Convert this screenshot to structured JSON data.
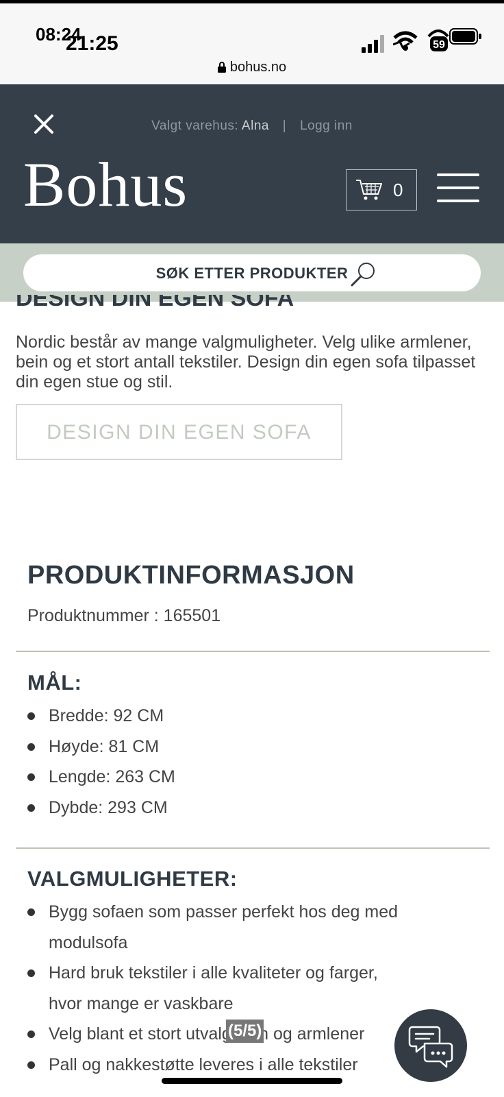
{
  "status_bar": {
    "time_primary": "08:24",
    "time_secondary": "21:25",
    "battery_level": "59",
    "url": "bohus.no"
  },
  "header": {
    "store_label": "Valgt varehus:",
    "store_name": "Alna",
    "separator": "|",
    "login_label": "Logg inn",
    "logo_text": "Bohus",
    "cart_count": "0"
  },
  "search": {
    "label": "SØK ETTER PRODUKTER"
  },
  "design_section": {
    "heading": "DESIGN DIN EGEN SOFA",
    "description": "Nordic består av mange valgmuligheter. Velg ulike armlener, bein og et stort antall tekstiler. Design din egen sofa tilpasset din egen stue og stil.",
    "button_label": "DESIGN DIN EGEN SOFA"
  },
  "product_info": {
    "title": "PRODUKTINFORMASJON",
    "product_number": "Produktnummer : 165501",
    "dimensions_title": "MÅL:",
    "dimensions": [
      "Bredde: 92 CM",
      "Høyde: 81 CM",
      "Lengde: 263 CM",
      "Dybde: 293 CM"
    ],
    "options_title": "VALGMULIGHETER:",
    "options": [
      "Bygg sofaen som passer perfekt hos deg med modulsofa",
      "Hard bruk tekstiler i alle kvaliteter og farger, hvor mange er vaskbare",
      "Velg blant et stort utvalg bein og armlener",
      "Pall og nakkestøtte leveres i alle tekstiler"
    ]
  },
  "overlay": {
    "page_indicator": "(5/5)"
  },
  "colors": {
    "header_bg": "#353f49",
    "search_band_bg": "#c7d0c6",
    "heading_text": "#2f3a44",
    "divider": "#c4bfb3"
  }
}
